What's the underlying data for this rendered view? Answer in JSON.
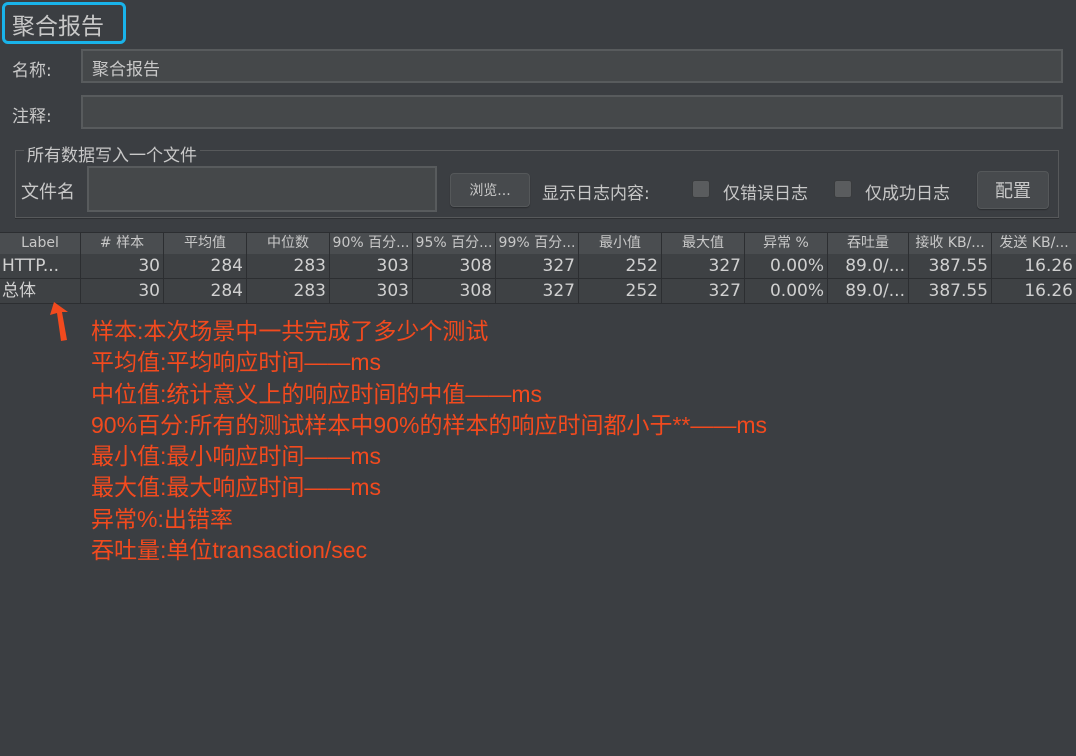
{
  "panel": {
    "title": "聚合报告",
    "name_label": "名称:",
    "name_value": "聚合报告",
    "comment_label": "注释:",
    "comment_value": ""
  },
  "file_group": {
    "legend": "所有数据写入一个文件",
    "filename_label": "文件名",
    "filename_value": "",
    "browse_button": "浏览...",
    "log_display_label": "显示日志内容:",
    "errors_only_label": "仅错误日志",
    "errors_only_checked": false,
    "success_only_label": "仅成功日志",
    "success_only_checked": false,
    "configure_button": "配置"
  },
  "table": {
    "columns": [
      "Label",
      "# 样本",
      "平均值",
      "中位数",
      "90% 百分...",
      "95% 百分...",
      "99% 百分...",
      "最小值",
      "最大值",
      "异常 %",
      "吞吐量",
      "接收 KB/...",
      "发送 KB/..."
    ],
    "rows": [
      [
        "HTTP...",
        "30",
        "284",
        "283",
        "303",
        "308",
        "327",
        "252",
        "327",
        "0.00%",
        "89.0/...",
        "387.55",
        "16.26"
      ],
      [
        "总体",
        "30",
        "284",
        "283",
        "303",
        "308",
        "327",
        "252",
        "327",
        "0.00%",
        "89.0/...",
        "387.55",
        "16.26"
      ]
    ]
  },
  "annotation": {
    "color": "#f24a1e",
    "arrow_icon": "arrow-up-icon",
    "lines": [
      "样本:本次场景中一共完成了多少个测试",
      "平均值:平均响应时间——ms",
      "中位值:统计意义上的响应时间的中值——ms",
      "90%百分:所有的测试样本中90%的样本的响应时间都小于**——ms",
      "最小值:最小响应时间——ms",
      "最大值:最大响应时间——ms",
      "异常%:出错率",
      "吞吐量:单位transaction/sec"
    ]
  },
  "colors": {
    "highlight": "#19b3ea",
    "background": "#3b3e42"
  }
}
